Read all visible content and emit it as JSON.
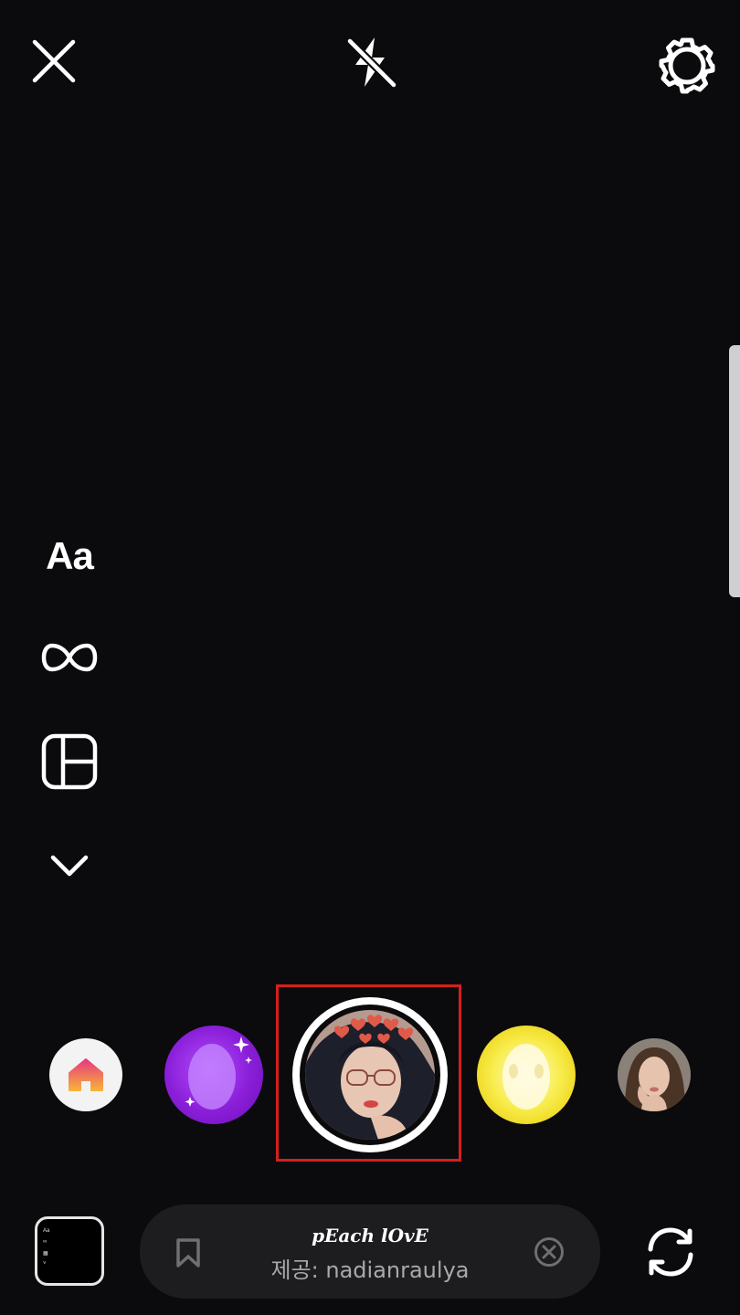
{
  "top_bar": {
    "close_icon": "close-icon",
    "flash_icon": "flash-off-icon",
    "settings_icon": "gear-icon"
  },
  "side_tools": {
    "text_label": "Aa",
    "boomerang_icon": "infinity-icon",
    "layout_icon": "layout-grid-icon",
    "more_icon": "chevron-down-icon"
  },
  "effects_tray": {
    "items": [
      {
        "name": "home-effect",
        "icon": "home-icon"
      },
      {
        "name": "purple-face-effect"
      },
      {
        "name": "selected-effect",
        "selected": true
      },
      {
        "name": "yellow-face-effect"
      },
      {
        "name": "portrait-effect"
      }
    ]
  },
  "effect_info": {
    "name": "pEach lOvE",
    "credit": "제공: nadianraulya",
    "bookmark_icon": "bookmark-icon",
    "clear_icon": "close-circle-icon"
  },
  "bottom": {
    "gallery_mini_text": [
      "Aa",
      "∞",
      "▦",
      "˅"
    ],
    "flip_icon": "flip-camera-icon"
  },
  "colors": {
    "background": "#0b0b0d",
    "highlight": "#d51f1f",
    "purple_effect": "#8a1ed8",
    "yellow_effect": "#f8ec4a",
    "home_icon": "#f0863a"
  }
}
